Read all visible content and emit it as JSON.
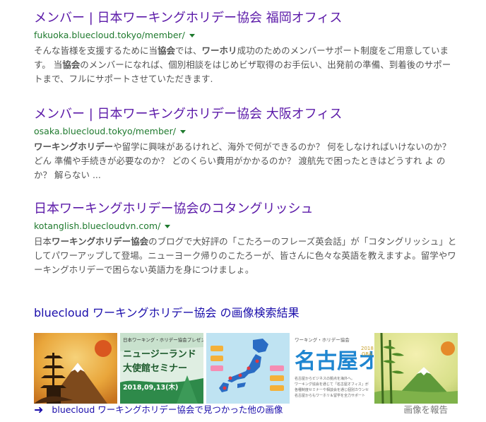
{
  "results": [
    {
      "title": "メンバー | 日本ワーキングホリデー協会 福岡オフィス",
      "url": "fukuoka.bluecloud.tokyo/member/",
      "snippet_html": "そんな皆様を支援するために当<b>協会</b>では、<b>ワーホリ</b>成功のためのメンバーサポート制度をご用意しています。 当<b>協会</b>のメンバーになれば、個別相談をはじめビザ取得のお手伝い、出発前の準備、到着後のサポートまで、フルにサポートさせていただきます."
    },
    {
      "title": "メンバー | 日本ワーキングホリデー協会 大阪オフィス",
      "url": "osaka.bluecloud.tokyo/member/",
      "snippet_html": "<b>ワーキングホリデー</b>や留学に興味があるけれど、海外で何ができるのか？ 何をしなければいけないのか？ どん 準備や手続きが必要なのか？ どのくらい費用がかかるのか？ 渡航先で困ったときはどうすれ よ のか？ 解らない ..."
    },
    {
      "title": "日本ワーキングホリデー協会のコタングリッシュ",
      "url": "kotanglish.bluecloudvn.com/",
      "snippet_html": "日本<b>ワーキングホリデー協会</b>のブログで大好評の「こたろーのフレーズ英会話」が「コタングリッシュ」としてパワーアップして登場。ニューヨーク帰りのこたろーが、皆さんに色々な英語を教えますよ。留学やワーキングホリデーで困らない英語力を身につけましょ。"
    }
  ],
  "images_section": {
    "heading": "bluecloud ワーキングホリデー協会 の画像検索結果",
    "thumb_texts": {
      "t2_top": "日本ワーキング・ホリデー協会プレゼン",
      "t2_main1": "ニュージーランド",
      "t2_main2": "大使館セミナー",
      "t2_date": "2018,09,13(木)",
      "t4_top": "ワーキング・ホリデー協会",
      "t4_main": "名古屋オ",
      "t4_year": "2018",
      "t4_gra": "GRA",
      "t4_desc1": "名古屋からビジネスの拠点を海外へ。",
      "t4_desc2": "ワーキング協会を通じて「名古屋オフィス」が",
      "t4_desc3": "各種制度セミナーや相談会を通じ個別カウンセ",
      "t4_desc4": "名古屋からもワーホリ＆留学を全力サポート"
    },
    "more_link_text": "bluecloud ワーキングホリデー協会で見つかった他の画像",
    "report_text": "画像を報告"
  },
  "colors": {
    "title_visited": "#5b19a8",
    "url_green": "#1f7a2e",
    "snippet_gray": "#545454",
    "link_blue": "#1a0dab"
  }
}
